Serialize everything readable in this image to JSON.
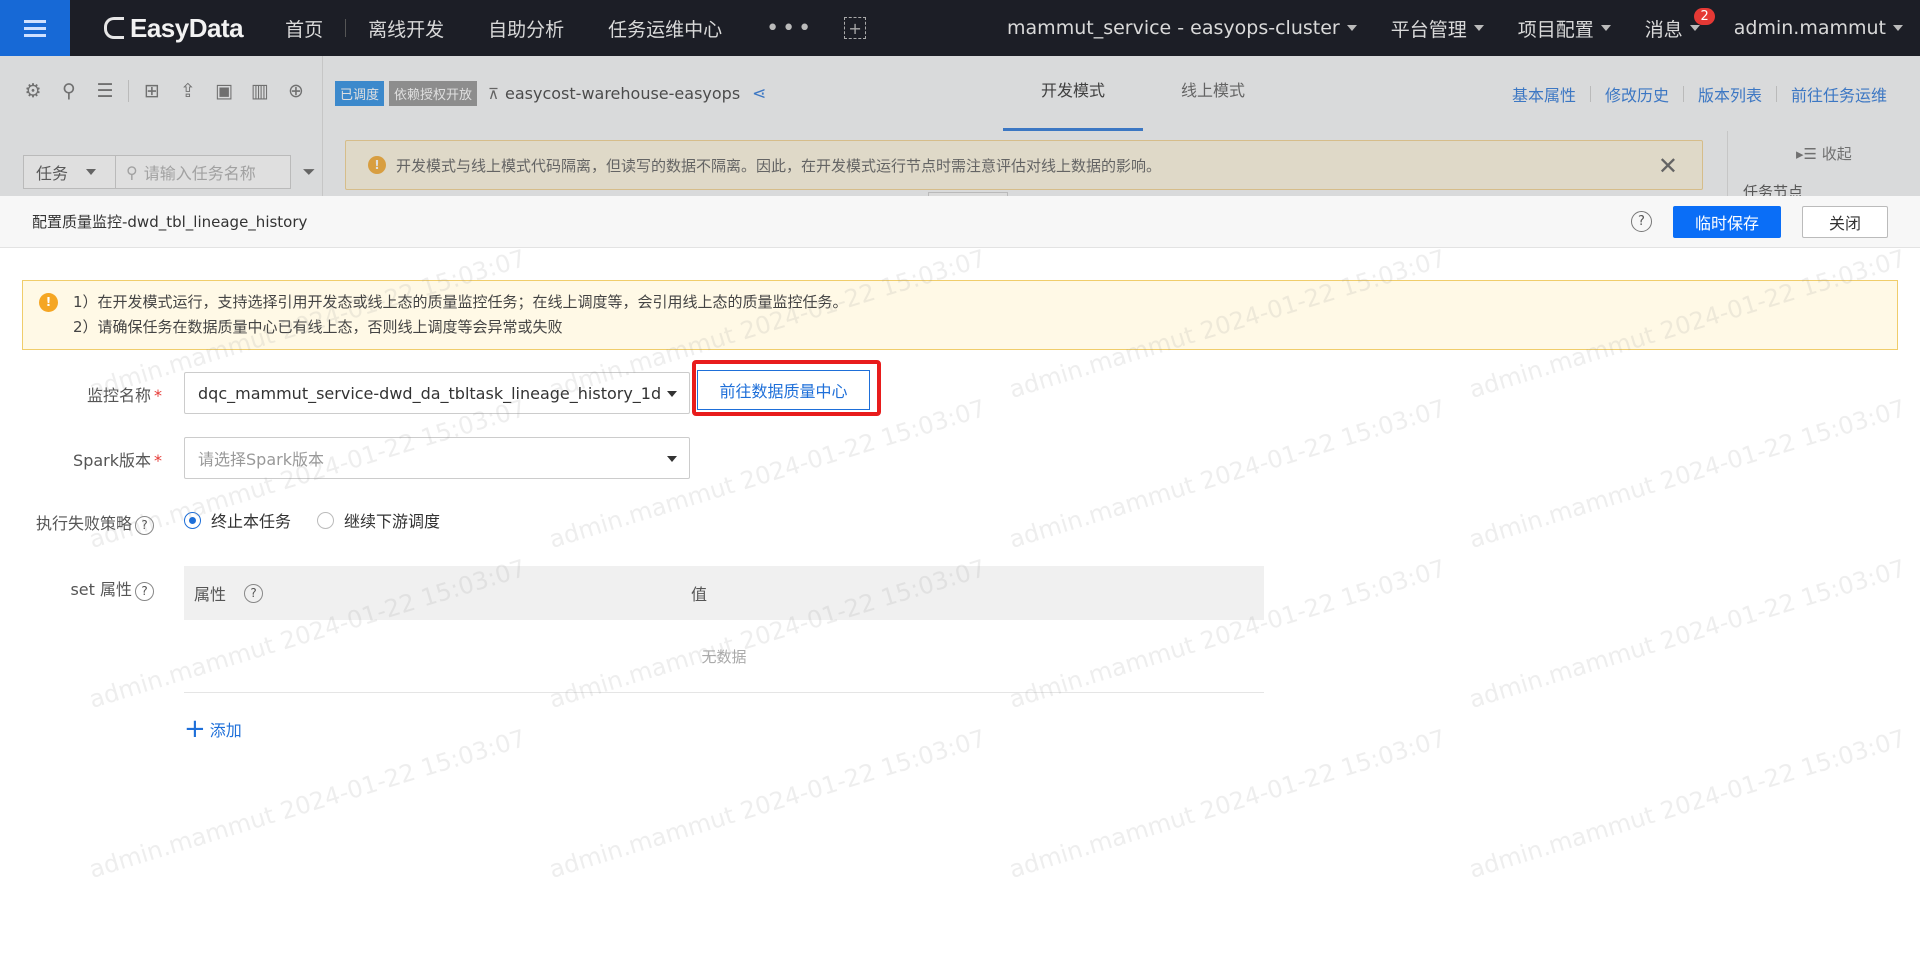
{
  "nav": {
    "logo": "EasyData",
    "items": [
      "首页",
      "离线开发",
      "自助分析",
      "任务运维中心"
    ],
    "more": "•••",
    "add": "+",
    "cluster": "mammut_service - easyops-cluster",
    "platform": "平台管理",
    "project_config": "项目配置",
    "messages": "消息",
    "message_count": "2",
    "user": "admin.mammut"
  },
  "left": {
    "task_select": "任务",
    "search_placeholder": "请输入任务名称"
  },
  "header": {
    "tag_scheduled": "已调度",
    "tag_auth": "依赖授权开放",
    "project": "easycost-warehouse-easyops",
    "tabs": [
      "开发模式",
      "线上模式"
    ],
    "links": [
      "基本属性",
      "修改历史",
      "版本列表",
      "前往任务运维"
    ],
    "warning": "开发模式与线上模式代码隔离，但读写的数据不隔离。因此，在开发模式运行节点时需注意评估对线上数据的影响。",
    "collapse": "收起",
    "node_title": "任务节点"
  },
  "drawer": {
    "title": "配置质量监控-dwd_tbl_lineage_history",
    "help": "?",
    "save": "临时保存",
    "close": "关闭",
    "notes": [
      "1）在开发模式运行，支持选择引用开发态或线上态的质量监控任务；在线上调度等，会引用线上态的质量监控任务。",
      "2）请确保任务在数据质量中心已有线上态，否则线上调度等会异常或失败"
    ],
    "form": {
      "monitor_label": "监控名称",
      "monitor_value": "dqc_mammut_service-dwd_da_tbltask_lineage_history_1d",
      "goto_button": "前往数据质量中心",
      "spark_label": "Spark版本",
      "spark_placeholder": "请选择Spark版本",
      "fail_label": "执行失败策略",
      "fail_options": [
        "终止本任务",
        "继续下游调度"
      ],
      "fail_selected": "终止本任务",
      "set_label": "set 属性",
      "col_attr": "属性",
      "col_value": "值",
      "empty": "无数据",
      "add": "添加"
    }
  },
  "watermark": "admin.mammut 2024-01-22 15:03:07",
  "colors": {
    "nav_bg": "#1c1e26",
    "primary": "#0a6ef7",
    "highlight": "#e81c1c",
    "warning": "#f5a623"
  }
}
